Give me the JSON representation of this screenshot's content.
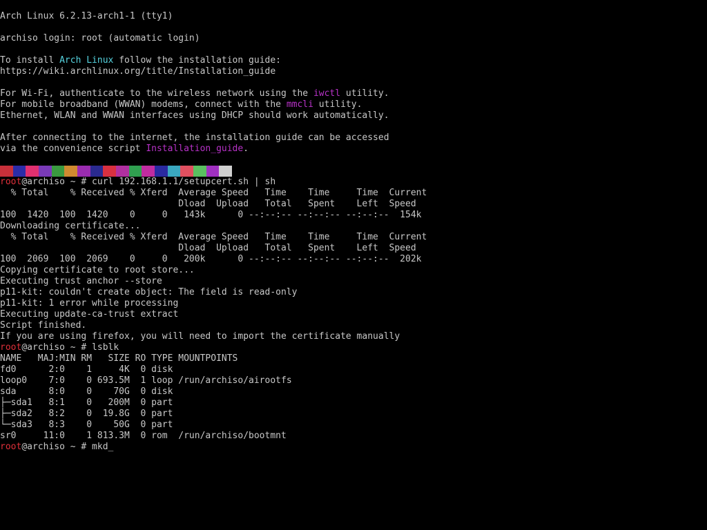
{
  "terminal": {
    "lines": [
      {
        "id": "l0",
        "segments": [
          {
            "text": "Arch Linux 6.2.13-arch1-1 (tty1)"
          }
        ]
      },
      {
        "id": "l1",
        "segments": [
          {
            "text": ""
          }
        ]
      },
      {
        "id": "l2",
        "segments": [
          {
            "text": "archiso login: root (automatic login)"
          }
        ]
      },
      {
        "id": "l3",
        "segments": [
          {
            "text": ""
          }
        ]
      },
      {
        "id": "l4",
        "segments": [
          {
            "text": "To install "
          },
          {
            "text": "Arch Linux",
            "color": "cyan"
          },
          {
            "text": " follow the installation guide:"
          }
        ]
      },
      {
        "id": "l5",
        "segments": [
          {
            "text": "https://wiki.archlinux.org/title/Installation_guide"
          }
        ]
      },
      {
        "id": "l6",
        "segments": [
          {
            "text": ""
          }
        ]
      },
      {
        "id": "l7",
        "segments": [
          {
            "text": "For Wi-Fi, authenticate to the wireless network using the "
          },
          {
            "text": "iwctl",
            "color": "magenta"
          },
          {
            "text": " utility."
          }
        ]
      },
      {
        "id": "l8",
        "segments": [
          {
            "text": "For mobile broadband (WWAN) modems, connect with the "
          },
          {
            "text": "mmcli",
            "color": "magenta"
          },
          {
            "text": " utility."
          }
        ]
      },
      {
        "id": "l9",
        "segments": [
          {
            "text": "Ethernet, WLAN and WWAN interfaces using DHCP should work automatically."
          }
        ]
      },
      {
        "id": "l10",
        "segments": [
          {
            "text": ""
          }
        ]
      },
      {
        "id": "l11",
        "segments": [
          {
            "text": "After connecting to the internet, the installation guide can be accessed"
          }
        ]
      },
      {
        "id": "l12",
        "segments": [
          {
            "text": "via the convenience script "
          },
          {
            "text": "Installation_guide",
            "color": "magenta"
          },
          {
            "text": "."
          }
        ]
      },
      {
        "id": "l13",
        "segments": [
          {
            "text": ""
          }
        ]
      },
      {
        "id": "l14",
        "segments": [
          {
            "text": ""
          }
        ]
      },
      {
        "id": "l15",
        "segments": [
          {
            "text": "root",
            "color": "red"
          },
          {
            "text": "@archiso ~ # curl 192.168.1.1/setupcert.sh | sh"
          }
        ]
      },
      {
        "id": "l16",
        "segments": [
          {
            "text": "  % Total    % Received % Xferd  Average Speed   Time    Time     Time  Current"
          }
        ]
      },
      {
        "id": "l17",
        "segments": [
          {
            "text": "                                 Dload  Upload   Total   Spent    Left  Speed"
          }
        ]
      },
      {
        "id": "l18",
        "segments": [
          {
            "text": "100  1420  100  1420    0     0   143k      0 --:--:-- --:--:-- --:--:--  154k"
          }
        ]
      },
      {
        "id": "l19",
        "segments": [
          {
            "text": "Downloading certificate..."
          }
        ]
      },
      {
        "id": "l20",
        "segments": [
          {
            "text": "  % Total    % Received % Xferd  Average Speed   Time    Time     Time  Current"
          }
        ]
      },
      {
        "id": "l21",
        "segments": [
          {
            "text": "                                 Dload  Upload   Total   Spent    Left  Speed"
          }
        ]
      },
      {
        "id": "l22",
        "segments": [
          {
            "text": "100  2069  100  2069    0     0   200k      0 --:--:-- --:--:-- --:--:--  202k"
          }
        ]
      },
      {
        "id": "l23",
        "segments": [
          {
            "text": "Copying certificate to root store..."
          }
        ]
      },
      {
        "id": "l24",
        "segments": [
          {
            "text": "Executing trust anchor --store"
          }
        ]
      },
      {
        "id": "l25",
        "segments": [
          {
            "text": "p11-kit: couldn't create object: The field is read-only"
          }
        ]
      },
      {
        "id": "l26",
        "segments": [
          {
            "text": "p11-kit: 1 error while processing"
          }
        ]
      },
      {
        "id": "l27",
        "segments": [
          {
            "text": "Executing update-ca-trust extract"
          }
        ]
      },
      {
        "id": "l28",
        "segments": [
          {
            "text": "Script finished."
          }
        ]
      },
      {
        "id": "l29",
        "segments": [
          {
            "text": "If you are using firefox, you will need to import the certificate manually"
          }
        ]
      },
      {
        "id": "l30",
        "segments": [
          {
            "text": "root",
            "color": "red"
          },
          {
            "text": "@archiso ~ # lsblk"
          }
        ]
      },
      {
        "id": "l31",
        "segments": [
          {
            "text": "NAME   MAJ:MIN RM   SIZE RO TYPE MOUNTPOINTS"
          }
        ]
      },
      {
        "id": "l32",
        "segments": [
          {
            "text": "fd0      2:0    1     4K  0 disk"
          }
        ]
      },
      {
        "id": "l33",
        "segments": [
          {
            "text": "loop0    7:0    0 693.5M  1 loop /run/archiso/airootfs"
          }
        ]
      },
      {
        "id": "l34",
        "segments": [
          {
            "text": "sda      8:0    0    70G  0 disk"
          }
        ]
      },
      {
        "id": "l35",
        "segments": [
          {
            "text": "├─sda1   8:1    0   200M  0 part"
          }
        ]
      },
      {
        "id": "l36",
        "segments": [
          {
            "text": "├─sda2   8:2    0  19.8G  0 part"
          }
        ]
      },
      {
        "id": "l37",
        "segments": [
          {
            "text": "└─sda3   8:3    0    50G  0 part"
          }
        ]
      },
      {
        "id": "l38",
        "segments": [
          {
            "text": "sr0     11:0    1 813.3M  0 rom  /run/archiso/bootmnt"
          }
        ]
      },
      {
        "id": "l39",
        "segments": [
          {
            "text": "root",
            "color": "red"
          },
          {
            "text": "@archiso ~ # mkd"
          },
          {
            "text": "_",
            "color": "cursor"
          }
        ]
      }
    ]
  },
  "colors": {
    "background": "#000000",
    "foreground": "#c8c8c8",
    "cyan": "#56d4e0",
    "magenta": "#b832c8",
    "red": "#e0303a"
  },
  "color_strip": {
    "blocks": [
      {
        "color": "#c8303a"
      },
      {
        "color": "#2c2ca8"
      },
      {
        "color": "#e03070"
      },
      {
        "color": "#7a3ab8"
      },
      {
        "color": "#3a9a40"
      },
      {
        "color": "#d08a30"
      },
      {
        "color": "#9a2cb0"
      },
      {
        "color": "#2a2a90"
      },
      {
        "color": "#d83040"
      },
      {
        "color": "#b030a0"
      },
      {
        "color": "#30a050"
      },
      {
        "color": "#c02ca0"
      },
      {
        "color": "#2a2aa0"
      },
      {
        "color": "#3aa8c0"
      },
      {
        "color": "#e05060"
      },
      {
        "color": "#5ac060"
      },
      {
        "color": "#a030c0"
      },
      {
        "color": "#d0d0d0"
      }
    ]
  }
}
